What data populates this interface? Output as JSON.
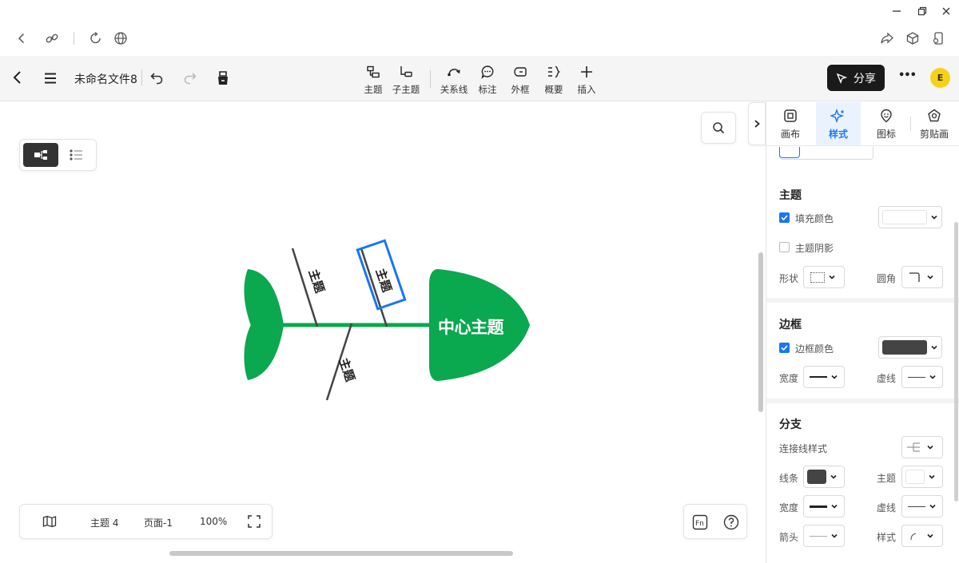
{
  "window": {
    "minimize_icon": "minimize-icon",
    "restore_icon": "restore-icon",
    "close_icon": "close-icon"
  },
  "browser": {
    "icons": [
      "back-icon",
      "link-icon",
      "reload-icon",
      "globe-icon",
      "share-arrow-icon",
      "cube-icon",
      "device-icon"
    ]
  },
  "toolbar": {
    "document_name": "未命名文件8",
    "tools": [
      {
        "label": "主题",
        "icon": "topic-icon"
      },
      {
        "label": "子主题",
        "icon": "subtopic-icon"
      },
      {
        "label": "关系线",
        "icon": "relation-line-icon"
      },
      {
        "label": "标注",
        "icon": "callout-icon"
      },
      {
        "label": "外框",
        "icon": "boundary-icon"
      },
      {
        "label": "概要",
        "icon": "summary-icon"
      },
      {
        "label": "插入",
        "icon": "plus-icon"
      }
    ],
    "share_label": "分享",
    "more_label": "•••",
    "avatar_initial": "E"
  },
  "canvas": {
    "center_topic": "中心主题",
    "branches": [
      "主题",
      "主题",
      "主题"
    ],
    "colors": {
      "fish": "#0aa84f",
      "selection": "#1877f2",
      "branch": "#444444"
    }
  },
  "status_bar": {
    "topic_count": "主题 4",
    "page": "页面-1",
    "zoom": "100%"
  },
  "panel": {
    "tabs": [
      {
        "label": "画布",
        "icon": "canvas-icon",
        "active": false
      },
      {
        "label": "样式",
        "icon": "sparkle-icon",
        "active": true
      },
      {
        "label": "图标",
        "icon": "marker-icon",
        "active": false
      },
      {
        "label": "剪贴画",
        "icon": "clipart-icon",
        "active": false
      }
    ],
    "topic": {
      "title": "主题",
      "fill_color_label": "填充颜色",
      "fill_checked": true,
      "shadow_label": "主题阴影",
      "shadow_checked": false,
      "shape_label": "形状",
      "corner_label": "圆角"
    },
    "border": {
      "title": "边框",
      "border_color_label": "边框颜色",
      "border_checked": true,
      "width_label": "宽度",
      "dash_label": "虚线",
      "color": "#444444"
    },
    "branch": {
      "title": "分支",
      "connector_label": "连接线样式",
      "line_label": "线条",
      "topic_label": "主题",
      "width_label": "宽度",
      "dash_label": "虚线",
      "arrow_label": "箭头",
      "style_label": "样式",
      "line_color": "#444444"
    }
  }
}
